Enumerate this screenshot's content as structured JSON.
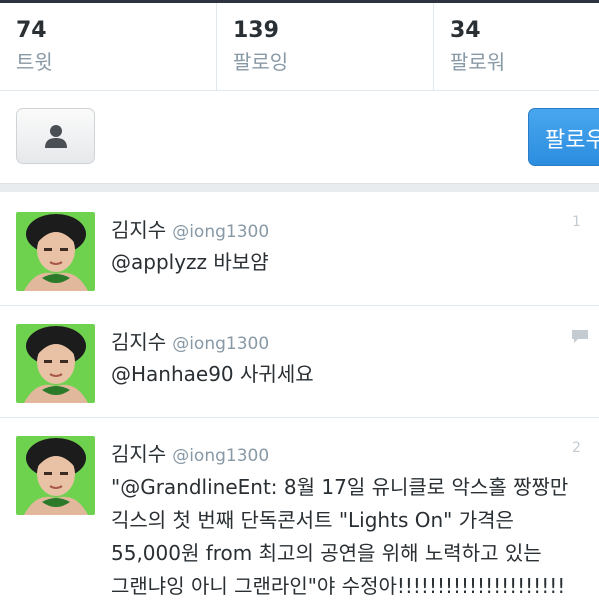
{
  "stats": [
    {
      "count": "74",
      "label": "트윗"
    },
    {
      "count": "139",
      "label": "팔로잉"
    },
    {
      "count": "34",
      "label": "팔로워"
    }
  ],
  "actions": {
    "person_icon": "person-icon",
    "follow_label": "팔로우"
  },
  "colors": {
    "accent": "#2c8de0",
    "muted_text": "#8899a6",
    "text": "#292f33"
  },
  "tweets": [
    {
      "name": "김지수",
      "handle": "@iong1300",
      "lines": [
        "@applyzz 바보얌"
      ]
    },
    {
      "name": "김지수",
      "handle": "@iong1300",
      "lines": [
        "@Hanhae90 사귀세요"
      ],
      "icon": "reply-bubble-icon"
    },
    {
      "name": "김지수",
      "handle": "@iong1300",
      "lines": [
        "\"@GrandlineEnt: 8월 17일 유니클로 악스홀 짱짱만",
        "긱스의 첫 번째 단독콘서트 \"Lights On\" 가격은",
        "55,000원 from 최고의 공연을 위해 노력하고 있는",
        "그랜냐잉 아니 그랜라인\"야 수정아!!!!!!!!!!!!!!!!!!!!!"
      ]
    }
  ]
}
